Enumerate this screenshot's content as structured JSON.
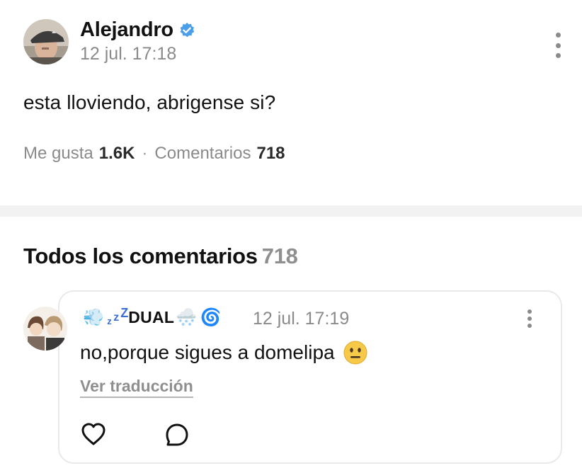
{
  "post": {
    "author": "Alejandro",
    "time": "12 jul. 17:18",
    "text": "esta lloviendo, abrigense si?",
    "likes_label": "Me gusta",
    "likes_count": "1.6K",
    "separator": "·",
    "comments_label": "Comentarios",
    "comments_count": "718"
  },
  "comments_section": {
    "title": "Todos los comentarios",
    "count": "718"
  },
  "comment": {
    "author_text": "DUAL",
    "author_emoji_left": "💨",
    "author_zzz": "zzZ",
    "author_emoji_right_1": "🌨️",
    "author_emoji_right_2": "🌀",
    "time": "12 jul. 17:19",
    "text": "no,porque sigues a domelipa",
    "emoji": "😐",
    "translate_label": "Ver traducción"
  },
  "icons": {
    "verified": "verified-badge-icon",
    "more": "more-vertical-icon",
    "like": "heart-outline-icon",
    "reply": "speech-bubble-icon"
  },
  "colors": {
    "verified_blue": "#4a9fe8",
    "muted_text": "#8a8a8a",
    "divider": "#f2f2f2",
    "card_border": "#e9e9e9"
  }
}
